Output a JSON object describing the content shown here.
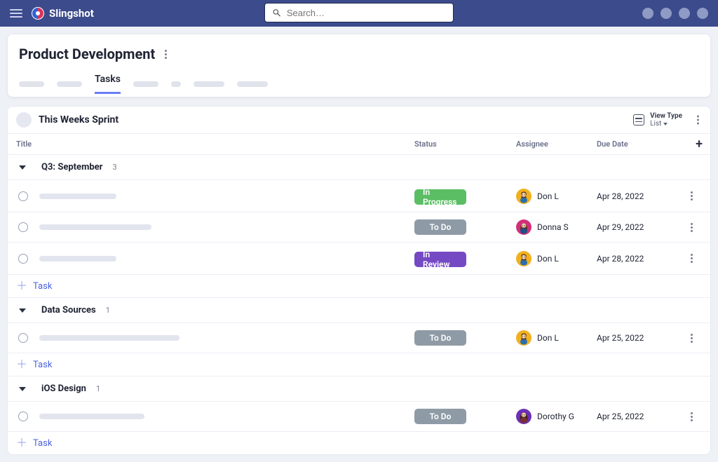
{
  "app": {
    "name": "Slingshot"
  },
  "search": {
    "placeholder": "Search…"
  },
  "header": {
    "title": "Product Development",
    "tabs": {
      "active": "Tasks"
    }
  },
  "project": {
    "name": "This Weeks Sprint",
    "viewType": {
      "label": "View Type",
      "value": "List"
    }
  },
  "columns": {
    "c0": "Title",
    "c1": "Status",
    "c2": "Assignee",
    "c3": "Due Date"
  },
  "groups": [
    {
      "name": "Q3: September",
      "count": "3",
      "tasks": [
        {
          "status": "In Progress",
          "statusClass": "st-inprogress",
          "assignee": "Don L",
          "due": "Apr 28, 2022",
          "skelW": 110,
          "avatar": "donl"
        },
        {
          "status": "To Do",
          "statusClass": "st-todo",
          "assignee": "Donna S",
          "due": "Apr 29, 2022",
          "skelW": 160,
          "avatar": "donnas"
        },
        {
          "status": "In Review",
          "statusClass": "st-inreview",
          "assignee": "Don L",
          "due": "Apr 28, 2022",
          "skelW": 110,
          "avatar": "donl"
        }
      ]
    },
    {
      "name": "Data Sources",
      "count": "1",
      "tasks": [
        {
          "status": "To Do",
          "statusClass": "st-todo",
          "assignee": "Don L",
          "due": "Apr 25, 2022",
          "skelW": 200,
          "avatar": "donl"
        }
      ]
    },
    {
      "name": "iOS Design",
      "count": "1",
      "tasks": [
        {
          "status": "To Do",
          "statusClass": "st-todo",
          "assignee": "Dorothy G",
          "due": "Apr 25, 2022",
          "skelW": 150,
          "avatar": "dorothyg"
        }
      ]
    }
  ],
  "labels": {
    "addTask": "Task"
  }
}
